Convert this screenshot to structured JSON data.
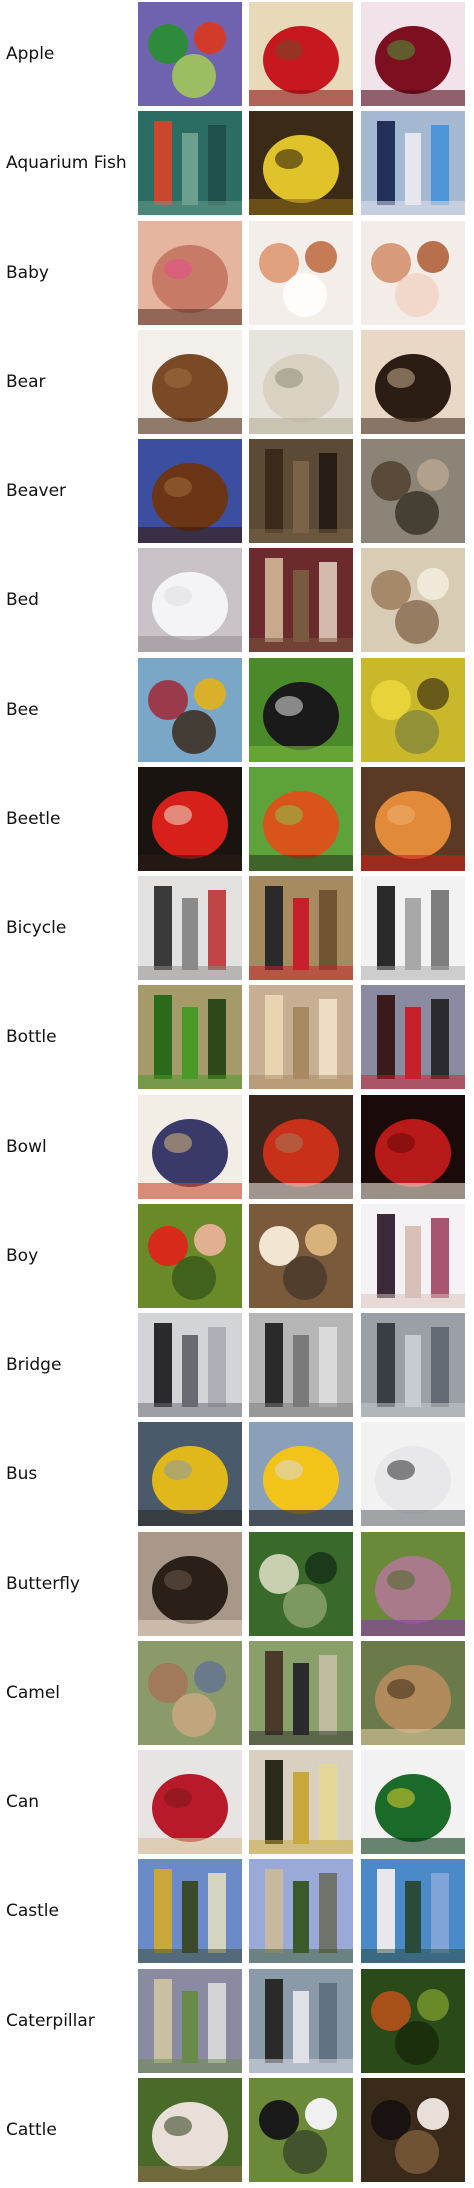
{
  "rows": [
    {
      "label": "Apple",
      "images": [
        {
          "name": "apple-photo-1",
          "bg": "#6f63b0",
          "colors": [
            "#2e8b3c",
            "#d23b2a",
            "#a6cc55"
          ],
          "shape": "blobs"
        },
        {
          "name": "apple-photo-2",
          "bg": "#e8d9b8",
          "colors": [
            "#c8181f",
            "#8c1014",
            "#6d4a2a"
          ],
          "shape": "big"
        },
        {
          "name": "apple-photo-3",
          "bg": "#f2e3ea",
          "colors": [
            "#7c1020",
            "#4f0a18",
            "#4a9b3a"
          ],
          "shape": "big"
        }
      ]
    },
    {
      "label": "Aquarium Fish",
      "images": [
        {
          "name": "aquarium-fish-photo-1",
          "bg": "#2c6d63",
          "colors": [
            "#c9472c",
            "#6c9f8e",
            "#1e4b47"
          ],
          "shape": "stripes"
        },
        {
          "name": "aquarium-fish-photo-2",
          "bg": "#3a2a16",
          "colors": [
            "#e0c22a",
            "#8a6a18",
            "#20160a"
          ],
          "shape": "big"
        },
        {
          "name": "aquarium-fish-photo-3",
          "bg": "#a4b8d2",
          "colors": [
            "#22305a",
            "#e6e6ee",
            "#3f8fd8"
          ],
          "shape": "stripes"
        }
      ]
    },
    {
      "label": "Baby",
      "images": [
        {
          "name": "baby-photo-1",
          "bg": "#e6b5a0",
          "colors": [
            "#c77a66",
            "#5a3326",
            "#e84b8c"
          ],
          "shape": "big"
        },
        {
          "name": "baby-photo-2",
          "bg": "#f4eeea",
          "colors": [
            "#e0a07e",
            "#c57b55",
            "#ffffff"
          ],
          "shape": "blobs"
        },
        {
          "name": "baby-photo-3",
          "bg": "#f3ece8",
          "colors": [
            "#d79b7b",
            "#b86f4c",
            "#f1d5c4"
          ],
          "shape": "blobs"
        }
      ]
    },
    {
      "label": "Bear",
      "images": [
        {
          "name": "bear-photo-1",
          "bg": "#f3f0ec",
          "colors": [
            "#7a4a26",
            "#4e2d14",
            "#a3703f"
          ],
          "shape": "big"
        },
        {
          "name": "bear-photo-2",
          "bg": "#e7e4de",
          "colors": [
            "#d9d2c2",
            "#b6ad98",
            "#8e8878"
          ],
          "shape": "big"
        },
        {
          "name": "bear-photo-3",
          "bg": "#e9d8c6",
          "colors": [
            "#2b1d14",
            "#4a3324",
            "#c9ad90"
          ],
          "shape": "big"
        }
      ]
    },
    {
      "label": "Beaver",
      "images": [
        {
          "name": "beaver-photo-1",
          "bg": "#3b4ea0",
          "colors": [
            "#6b3516",
            "#3a1c0a",
            "#a06b3a"
          ],
          "shape": "big"
        },
        {
          "name": "beaver-photo-2",
          "bg": "#5a4a36",
          "colors": [
            "#3a2a1c",
            "#7a6347",
            "#1f170f"
          ],
          "shape": "stripes"
        },
        {
          "name": "beaver-photo-3",
          "bg": "#8c8577",
          "colors": [
            "#5a4a3a",
            "#b0a08c",
            "#3a3228"
          ],
          "shape": "blobs"
        }
      ]
    },
    {
      "label": "Bed",
      "images": [
        {
          "name": "bed-photo-1",
          "bg": "#c9c3c9",
          "colors": [
            "#f4f4f6",
            "#9a8f94",
            "#dcdce4"
          ],
          "shape": "big"
        },
        {
          "name": "bed-photo-2",
          "bg": "#6a2a2e",
          "colors": [
            "#c9a98e",
            "#7a5a3e",
            "#e6d4c2"
          ],
          "shape": "stripes"
        },
        {
          "name": "bed-photo-3",
          "bg": "#d9ccb4",
          "colors": [
            "#a6886a",
            "#f0e8d8",
            "#8a6e52"
          ],
          "shape": "blobs"
        }
      ]
    },
    {
      "label": "Bee",
      "images": [
        {
          "name": "bee-photo-1",
          "bg": "#7aa6c8",
          "colors": [
            "#9a3a4a",
            "#d8b02a",
            "#3a2a1c"
          ],
          "shape": "blobs"
        },
        {
          "name": "bee-photo-2",
          "bg": "#4a8a2a",
          "colors": [
            "#1a1a1a",
            "#7ab83a",
            "#e6e6e6"
          ],
          "shape": "big"
        },
        {
          "name": "bee-photo-3",
          "bg": "#c9b82a",
          "colors": [
            "#e8d43a",
            "#6a5a1a",
            "#8a8a3a"
          ],
          "shape": "blobs"
        }
      ]
    },
    {
      "label": "Beetle",
      "images": [
        {
          "name": "beetle-photo-1",
          "bg": "#1a1410",
          "colors": [
            "#d8201a",
            "#2a1a14",
            "#f0e0d0"
          ],
          "shape": "big"
        },
        {
          "name": "beetle-photo-2",
          "bg": "#5ea23a",
          "colors": [
            "#d8541a",
            "#2a3a1a",
            "#8ac24a"
          ],
          "shape": "big"
        },
        {
          "name": "beetle-photo-3",
          "bg": "#5a3a22",
          "colors": [
            "#e08a3a",
            "#c8201a",
            "#f0b070"
          ],
          "shape": "big"
        }
      ]
    },
    {
      "label": "Bicycle",
      "images": [
        {
          "name": "bicycle-photo-1",
          "bg": "#e4e2e0",
          "colors": [
            "#3a3a3a",
            "#8a8a8a",
            "#b82a2a"
          ],
          "shape": "stripes"
        },
        {
          "name": "bicycle-photo-2",
          "bg": "#a68a60",
          "colors": [
            "#2a2a2a",
            "#c8202a",
            "#6a4a2a"
          ],
          "shape": "stripes"
        },
        {
          "name": "bicycle-photo-3",
          "bg": "#f2f2f2",
          "colors": [
            "#2a2a2a",
            "#a8a8a8",
            "#6a6a6a"
          ],
          "shape": "stripes"
        }
      ]
    },
    {
      "label": "Bottle",
      "images": [
        {
          "name": "bottle-photo-1",
          "bg": "#a49a6a",
          "colors": [
            "#2a6a1a",
            "#4a9a2a",
            "#1a3a0a"
          ],
          "shape": "stripes"
        },
        {
          "name": "bottle-photo-2",
          "bg": "#c8ae92",
          "colors": [
            "#e8d4b0",
            "#a88a62",
            "#f2e6cc"
          ],
          "shape": "stripes"
        },
        {
          "name": "bottle-photo-3",
          "bg": "#8a8aa0",
          "colors": [
            "#3a1a1a",
            "#c8202a",
            "#1a1a1a"
          ],
          "shape": "stripes"
        }
      ]
    },
    {
      "label": "Bowl",
      "images": [
        {
          "name": "bowl-photo-1",
          "bg": "#f2eee6",
          "colors": [
            "#3a3a6a",
            "#c84a2a",
            "#d8b87a"
          ],
          "shape": "big"
        },
        {
          "name": "bowl-photo-2",
          "bg": "#3a261c",
          "colors": [
            "#c8301a",
            "#e8e0d8",
            "#a87a5a"
          ],
          "shape": "big"
        },
        {
          "name": "bowl-photo-3",
          "bg": "#1a0a0a",
          "colors": [
            "#b81a1a",
            "#f4e8d8",
            "#6a0a0a"
          ],
          "shape": "big"
        }
      ]
    },
    {
      "label": "Boy",
      "images": [
        {
          "name": "boy-photo-1",
          "bg": "#6a8a2a",
          "colors": [
            "#d82a1a",
            "#e0b090",
            "#3a5a1a"
          ],
          "shape": "blobs"
        },
        {
          "name": "boy-photo-2",
          "bg": "#7a5a3a",
          "colors": [
            "#f2e6d2",
            "#d8b27a",
            "#4a3a2a"
          ],
          "shape": "blobs"
        },
        {
          "name": "boy-photo-3",
          "bg": "#f4f2f4",
          "colors": [
            "#3a2a3a",
            "#d8c0b8",
            "#9a3a5a"
          ],
          "shape": "stripes"
        }
      ]
    },
    {
      "label": "Bridge",
      "images": [
        {
          "name": "bridge-photo-1",
          "bg": "#d2d4d8",
          "colors": [
            "#2a2a2e",
            "#6a6a72",
            "#a6a8b0"
          ],
          "shape": "stripes"
        },
        {
          "name": "bridge-photo-2",
          "bg": "#b6b6b6",
          "colors": [
            "#2a2a2a",
            "#7a7a7a",
            "#e0e0e0"
          ],
          "shape": "stripes"
        },
        {
          "name": "bridge-photo-3",
          "bg": "#9aa0a6",
          "colors": [
            "#3a3e44",
            "#c8ccd0",
            "#5a6068"
          ],
          "shape": "stripes"
        }
      ]
    },
    {
      "label": "Bus",
      "images": [
        {
          "name": "bus-photo-1",
          "bg": "#4a5a6a",
          "colors": [
            "#e0b81a",
            "#2a2a2a",
            "#8a9aa8"
          ],
          "shape": "big"
        },
        {
          "name": "bus-photo-2",
          "bg": "#8aa0b8",
          "colors": [
            "#f2c41a",
            "#1a1a1a",
            "#d8d8d8"
          ],
          "shape": "big"
        },
        {
          "name": "bus-photo-3",
          "bg": "#f2f2f2",
          "colors": [
            "#e8e8ea",
            "#6a6e74",
            "#2a2a2e"
          ],
          "shape": "big"
        }
      ]
    },
    {
      "label": "Butterfly",
      "images": [
        {
          "name": "butterfly-photo-1",
          "bg": "#a8988a",
          "colors": [
            "#2a2018",
            "#e0d0c0",
            "#6a5a4a"
          ],
          "shape": "big"
        },
        {
          "name": "butterfly-photo-2",
          "bg": "#3a6a2a",
          "colors": [
            "#c8d0b0",
            "#1a3a1a",
            "#8aa06a"
          ],
          "shape": "blobs"
        },
        {
          "name": "butterfly-photo-3",
          "bg": "#6a8a3a",
          "colors": [
            "#a87a8a",
            "#8a3aa8",
            "#4a6a2a"
          ],
          "shape": "big"
        }
      ]
    },
    {
      "label": "Camel",
      "images": [
        {
          "name": "camel-photo-1",
          "bg": "#8a9a6a",
          "colors": [
            "#a07a5a",
            "#6a7a8a",
            "#c8a880"
          ],
          "shape": "blobs"
        },
        {
          "name": "camel-photo-2",
          "bg": "#8aa06a",
          "colors": [
            "#4a3a2a",
            "#2a2a2a",
            "#c8c0a8"
          ],
          "shape": "stripes"
        },
        {
          "name": "camel-photo-3",
          "bg": "#6a7a4a",
          "colors": [
            "#b08a5a",
            "#e0c8a0",
            "#3a2a1a"
          ],
          "shape": "big"
        }
      ]
    },
    {
      "label": "Can",
      "images": [
        {
          "name": "can-photo-1",
          "bg": "#e8e4e4",
          "colors": [
            "#b81a2a",
            "#d8c098",
            "#7a1a1a"
          ],
          "shape": "big"
        },
        {
          "name": "can-photo-2",
          "bg": "#d8d0c0",
          "colors": [
            "#2a2a1a",
            "#c8a83a",
            "#e8d890"
          ],
          "shape": "stripes"
        },
        {
          "name": "can-photo-3",
          "bg": "#f2f2f2",
          "colors": [
            "#1a6a2a",
            "#0a3a1a",
            "#e0d02a"
          ],
          "shape": "big"
        }
      ]
    },
    {
      "label": "Castle",
      "images": [
        {
          "name": "castle-photo-1",
          "bg": "#6a8ac8",
          "colors": [
            "#c8a83a",
            "#3a4a2a",
            "#e8e0c0"
          ],
          "shape": "stripes"
        },
        {
          "name": "castle-photo-2",
          "bg": "#9aaad8",
          "colors": [
            "#c8b8a0",
            "#3a5a2a",
            "#6a6a5a"
          ],
          "shape": "stripes"
        },
        {
          "name": "castle-photo-3",
          "bg": "#4a8ac8",
          "colors": [
            "#e8e8ec",
            "#2a4a3a",
            "#8aa8d8"
          ],
          "shape": "stripes"
        }
      ]
    },
    {
      "label": "Caterpillar",
      "images": [
        {
          "name": "caterpillar-photo-1",
          "bg": "#8a8aa0",
          "colors": [
            "#c8c0a0",
            "#6a8a4a",
            "#e0e0e0"
          ],
          "shape": "stripes"
        },
        {
          "name": "caterpillar-photo-2",
          "bg": "#8a9aa8",
          "colors": [
            "#2a2a2a",
            "#e0e0e8",
            "#5a6a7a"
          ],
          "shape": "stripes"
        },
        {
          "name": "caterpillar-photo-3",
          "bg": "#2a4a1a",
          "colors": [
            "#a8501a",
            "#6a8a2a",
            "#1a2a0a"
          ],
          "shape": "blobs"
        }
      ]
    },
    {
      "label": "Cattle",
      "images": [
        {
          "name": "cattle-photo-1",
          "bg": "#4a6a2a",
          "colors": [
            "#e8e0d8",
            "#8a6a4a",
            "#2a3a1a"
          ],
          "shape": "big"
        },
        {
          "name": "cattle-photo-2",
          "bg": "#6a8a3a",
          "colors": [
            "#1a1a1a",
            "#f0f0f0",
            "#3a4a2a"
          ],
          "shape": "blobs"
        },
        {
          "name": "cattle-photo-3",
          "bg": "#3a2a1a",
          "colors": [
            "#1a1210",
            "#e8e0d8",
            "#7a5a3a"
          ],
          "shape": "blobs"
        }
      ]
    }
  ]
}
